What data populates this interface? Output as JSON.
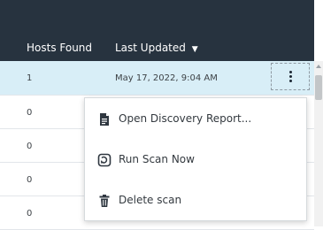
{
  "table": {
    "columns": {
      "hosts_found": "Hosts Found",
      "last_updated": "Last Updated",
      "sort_indicator": "▼"
    },
    "rows": [
      {
        "hosts_found": "1",
        "last_updated": "May 17, 2022, 9:04 AM",
        "selected": true
      },
      {
        "hosts_found": "0",
        "last_updated": ""
      },
      {
        "hosts_found": "0",
        "last_updated": ""
      },
      {
        "hosts_found": "0",
        "last_updated": ""
      },
      {
        "hosts_found": "0",
        "last_updated": ""
      }
    ]
  },
  "context_menu": {
    "items": [
      {
        "label": "Open Discovery Report...",
        "icon": "document-icon"
      },
      {
        "label": "Run Scan Now",
        "icon": "run-scan-icon"
      },
      {
        "label": "Delete scan",
        "icon": "trash-icon"
      }
    ]
  },
  "colors": {
    "header_bg": "#27333f",
    "selected_row": "#d8eef7"
  }
}
